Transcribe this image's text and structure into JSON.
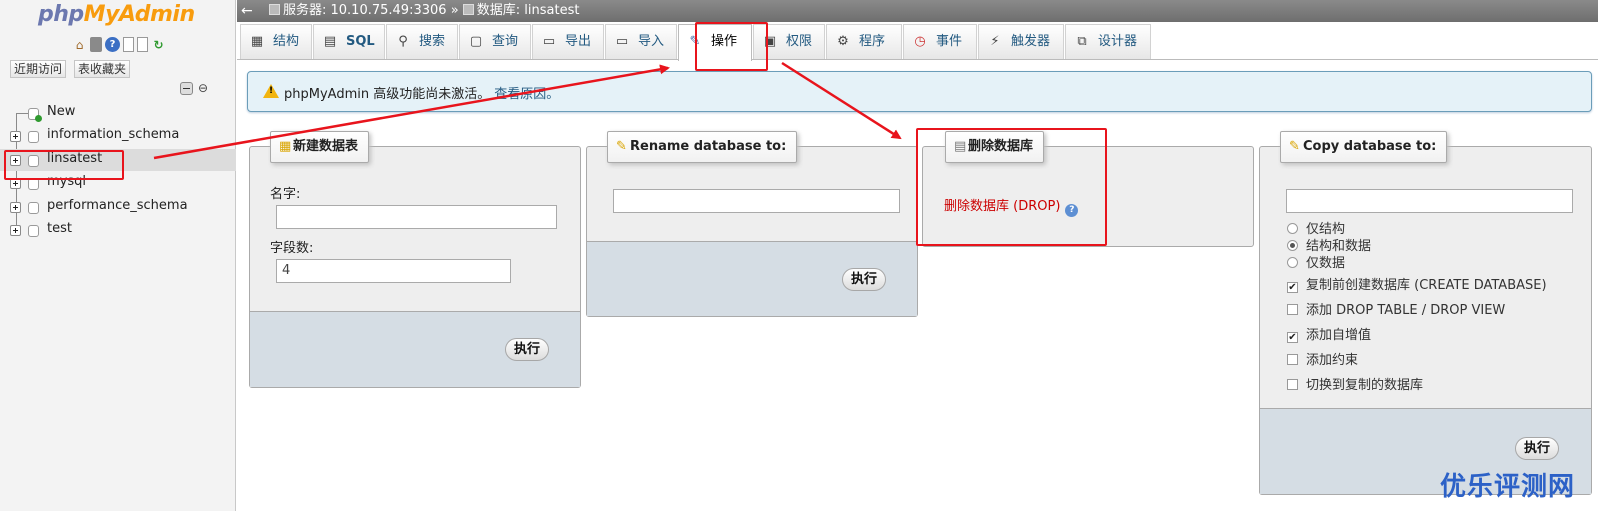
{
  "nav": {
    "logo_part1": "php",
    "logo_part2": "MyAdmin",
    "recent_label": "近期访问",
    "favorites_label": "表收藏夹",
    "tree": [
      {
        "label": "New"
      },
      {
        "label": "information_schema"
      },
      {
        "label": "linsatest",
        "selected": true
      },
      {
        "label": "mysql"
      },
      {
        "label": "performance_schema"
      },
      {
        "label": "test"
      }
    ]
  },
  "topbar": {
    "server_label": "服务器: 10.10.75.49:3306",
    "separator": "»",
    "db_label": "数据库: linsatest"
  },
  "tabs": [
    {
      "label": "结构",
      "icon": "structure-icon"
    },
    {
      "label": "SQL",
      "icon": "sql-icon"
    },
    {
      "label": "搜索",
      "icon": "search-icon"
    },
    {
      "label": "查询",
      "icon": "query-icon"
    },
    {
      "label": "导出",
      "icon": "export-icon"
    },
    {
      "label": "导入",
      "icon": "import-icon"
    },
    {
      "label": "操作",
      "icon": "wrench-icon",
      "active": true
    },
    {
      "label": "权限",
      "icon": "privileges-icon"
    },
    {
      "label": "程序",
      "icon": "routines-icon"
    },
    {
      "label": "事件",
      "icon": "events-icon"
    },
    {
      "label": "触发器",
      "icon": "triggers-icon"
    },
    {
      "label": "设计器",
      "icon": "designer-icon"
    }
  ],
  "notice": {
    "text": "phpMyAdmin 高级功能尚未激活。",
    "link": "查看原因。"
  },
  "create_table": {
    "legend": "新建数据表",
    "name_label": "名字:",
    "name_value": "",
    "fields_label": "字段数:",
    "fields_value": "4",
    "execute": "执行"
  },
  "rename_db": {
    "legend": "Rename database to:",
    "value": "",
    "execute": "执行"
  },
  "drop_db": {
    "legend": "删除数据库",
    "link": "删除数据库 (DROP)"
  },
  "copy_db": {
    "legend": "Copy database to:",
    "value": "",
    "radio_options": [
      {
        "label": "仅结构",
        "checked": false
      },
      {
        "label": "结构和数据",
        "checked": true
      },
      {
        "label": "仅数据",
        "checked": false
      }
    ],
    "checkbox_options": [
      {
        "label": "复制前创建数据库 (CREATE DATABASE)",
        "checked": true
      },
      {
        "label": "添加 DROP TABLE / DROP VIEW",
        "checked": false
      },
      {
        "label": "添加自增值",
        "checked": true
      },
      {
        "label": "添加约束",
        "checked": false
      },
      {
        "label": "切换到复制的数据库",
        "checked": false
      }
    ],
    "execute": "执行"
  },
  "watermark": "优乐评测网",
  "colors": {
    "annotation_red": "#e8141c",
    "link_blue": "#235a81",
    "drop_red": "#cc0000",
    "logo_blue": "#6c78af",
    "logo_orange": "#f89c0e"
  }
}
